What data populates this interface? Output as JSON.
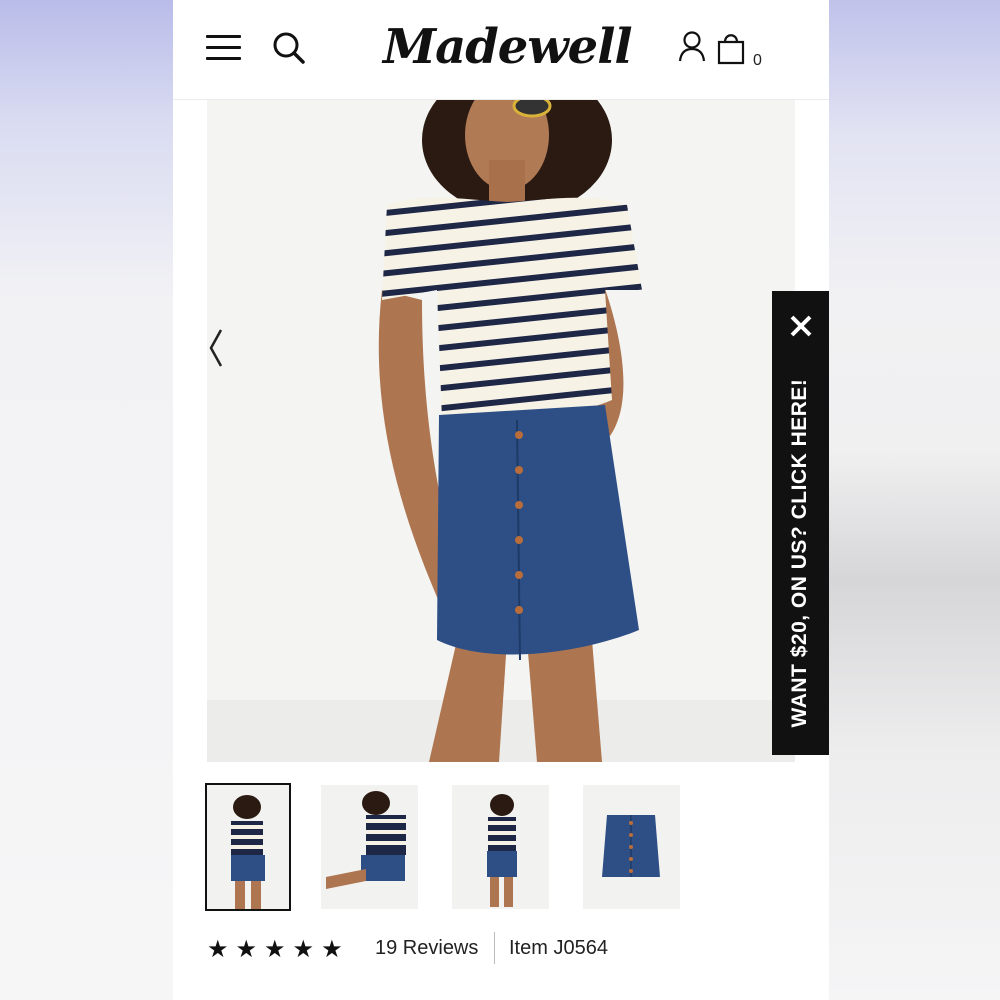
{
  "header": {
    "brand": "Madewell",
    "bag_count": "0",
    "icons": [
      "menu-icon",
      "search-icon",
      "account-icon",
      "shopping-bag-icon"
    ]
  },
  "gallery": {
    "images": [
      "model-front",
      "model-seated",
      "model-back",
      "skirt-flat"
    ],
    "active_index": 0
  },
  "promo": {
    "text": "WANT $20, ON US? CLICK HERE!",
    "close_icon": "close-icon",
    "background": "#111111"
  },
  "product": {
    "rating": 5,
    "stars": "★★★★★",
    "reviews": "19 Reviews",
    "item": "Item J0564"
  },
  "colors": {
    "denim": "#2d4f86",
    "stripe": "#1f2747"
  }
}
